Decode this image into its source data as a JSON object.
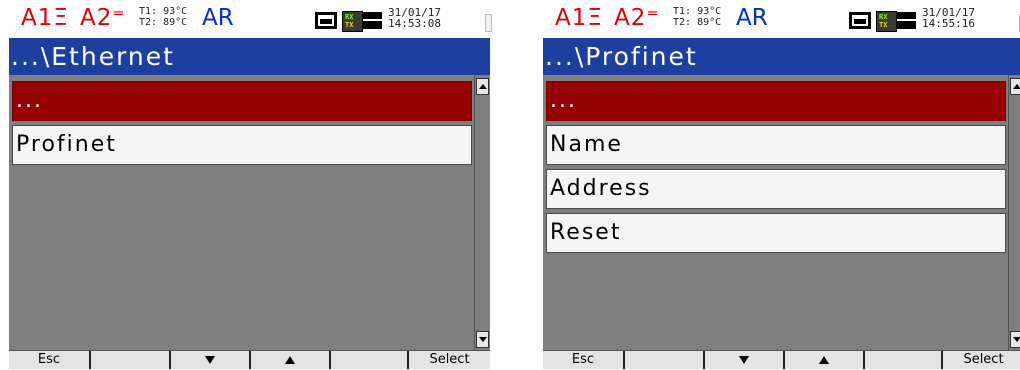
{
  "colors": {
    "alarm": "#e60000",
    "ar": "#0033cc",
    "titlebar": "#1d3f9f",
    "selected": "#950000",
    "content_bg": "#7f7f7f",
    "item_bg": "#f5f5f5"
  },
  "screens": [
    {
      "status": {
        "alarm1": "A1Ξ",
        "alarm2": "A2⁼",
        "t1": "T1: 93°C",
        "t2": "T2: 89°C",
        "mode": "AR",
        "rx": "RX",
        "tx": "TX",
        "date": "31/01/17",
        "time": "14:53:08"
      },
      "title": "...\\Ethernet",
      "items": [
        "...",
        "Profinet"
      ],
      "softkeys": [
        "Esc",
        "",
        "down-arrow-icon",
        "up-arrow-icon",
        "",
        "Select"
      ]
    },
    {
      "status": {
        "alarm1": "A1Ξ",
        "alarm2": "A2⁼",
        "t1": "T1: 93°C",
        "t2": "T2: 89°C",
        "mode": "AR",
        "rx": "RX",
        "tx": "TX",
        "date": "31/01/17",
        "time": "14:55:16"
      },
      "title": "...\\Profinet",
      "items": [
        "...",
        "Name",
        "Address",
        "Reset"
      ],
      "softkeys": [
        "Esc",
        "",
        "down-arrow-icon",
        "up-arrow-icon",
        "",
        "Select"
      ]
    }
  ]
}
